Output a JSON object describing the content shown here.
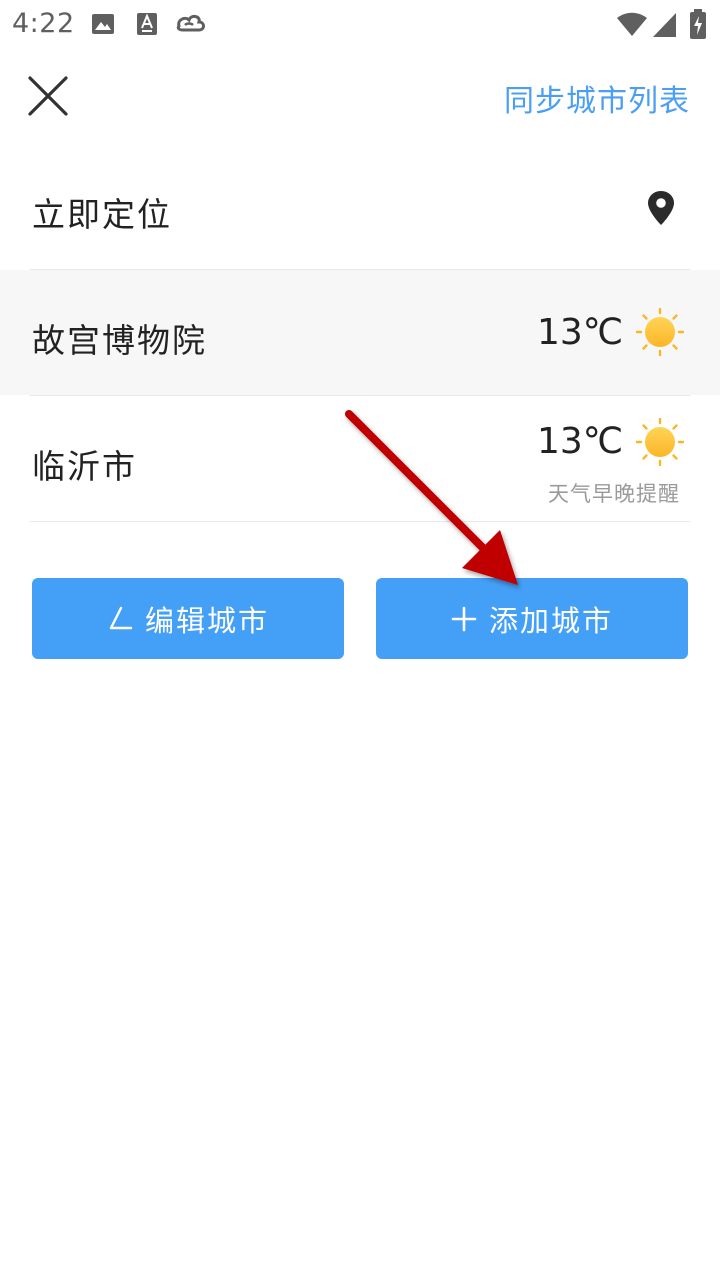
{
  "status_bar": {
    "time": "4:22",
    "icons": [
      "image-icon",
      "font-icon",
      "cloud-icon"
    ],
    "right_icons": [
      "wifi-icon",
      "cell-signal-icon",
      "battery-charging-icon"
    ]
  },
  "header": {
    "close_icon": "close-icon",
    "sync_label": "同步城市列表"
  },
  "locate": {
    "label": "立即定位",
    "icon": "location-pin-icon"
  },
  "cities": [
    {
      "name": "故宫博物院",
      "temp": "13℃",
      "weather_icon": "sun-icon",
      "note": ""
    },
    {
      "name": "临沂市",
      "temp": "13℃",
      "weather_icon": "sun-icon",
      "note": "天气早晚提醒"
    }
  ],
  "actions": {
    "edit_label": "编辑城市",
    "add_label": "添加城市"
  },
  "colors": {
    "accent": "#449ff7",
    "link": "#4a9ef5",
    "sun": "#fdbf2d",
    "annotation_arrow": "#c00000"
  }
}
